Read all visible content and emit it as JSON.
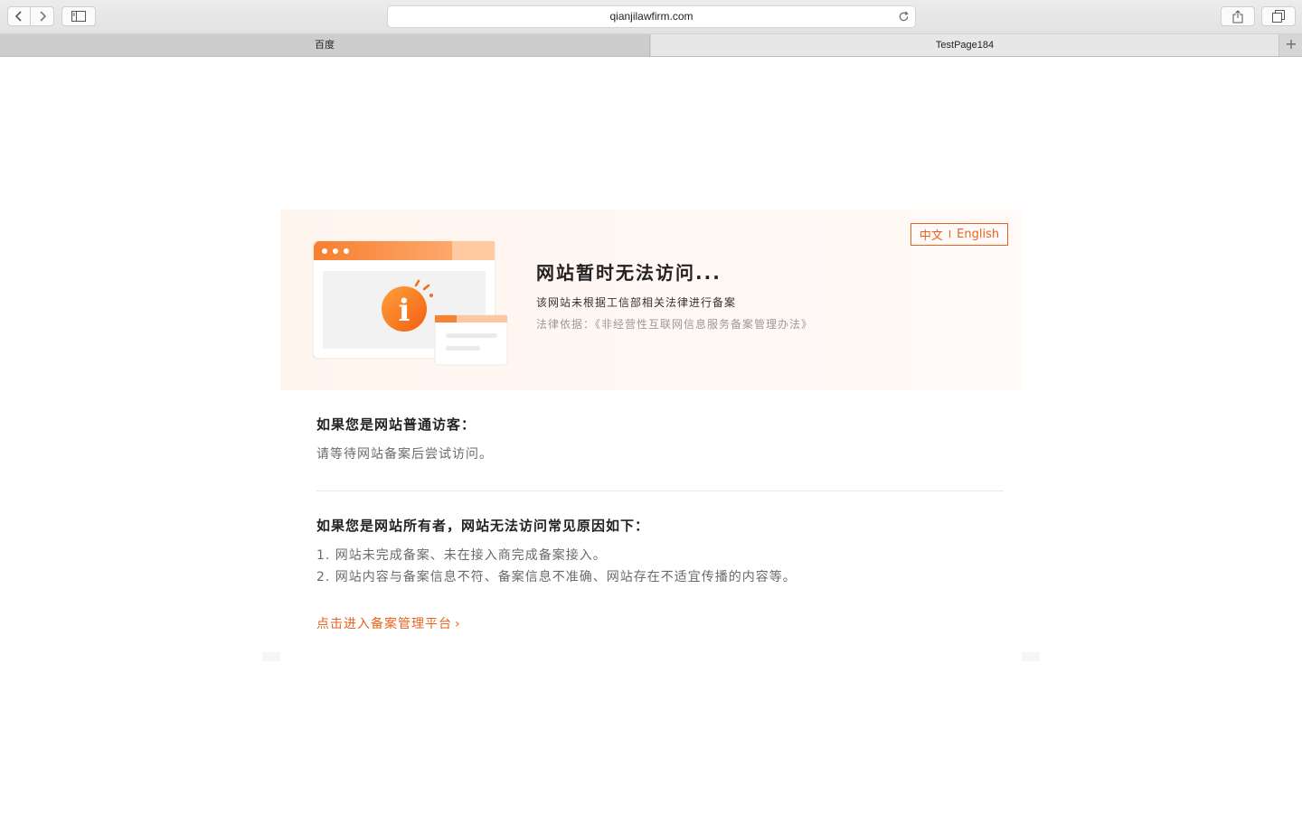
{
  "browser": {
    "url": "qianjilawfirm.com",
    "tabs": [
      {
        "label": "百度"
      },
      {
        "label": "TestPage184"
      }
    ],
    "new_tab_symbol": "+",
    "icons": {
      "back": "chevron-left-icon",
      "forward": "chevron-right-icon",
      "sidebar": "sidebar-icon",
      "reload": "reload-icon",
      "share": "share-icon",
      "tabs": "tabs-overview-icon"
    }
  },
  "banner": {
    "lang_zh": "中文",
    "lang_sep": "I",
    "lang_en": "English",
    "headline": "网站暂时无法访问...",
    "notice": "该网站未根据工信部相关法律进行备案",
    "legal": "法律依据：《非经营性互联网信息服务备案管理办法》",
    "illustration_icon": "info-icon"
  },
  "visitor": {
    "title": "如果您是网站普通访客：",
    "text": "请等待网站备案后尝试访问。"
  },
  "owner": {
    "title": "如果您是网站所有者，网站无法访问常见原因如下：",
    "reasons": [
      "1. 网站未完成备案、未在接入商完成备案接入。",
      "2. 网站内容与备案信息不符、备案信息不准确、网站存在不适宜传播的内容等。"
    ]
  },
  "link": {
    "label": "点击进入备案管理平台",
    "chevron": "›"
  },
  "colors": {
    "accent": "#e8631e",
    "banner_bg": "#fff5ef"
  }
}
